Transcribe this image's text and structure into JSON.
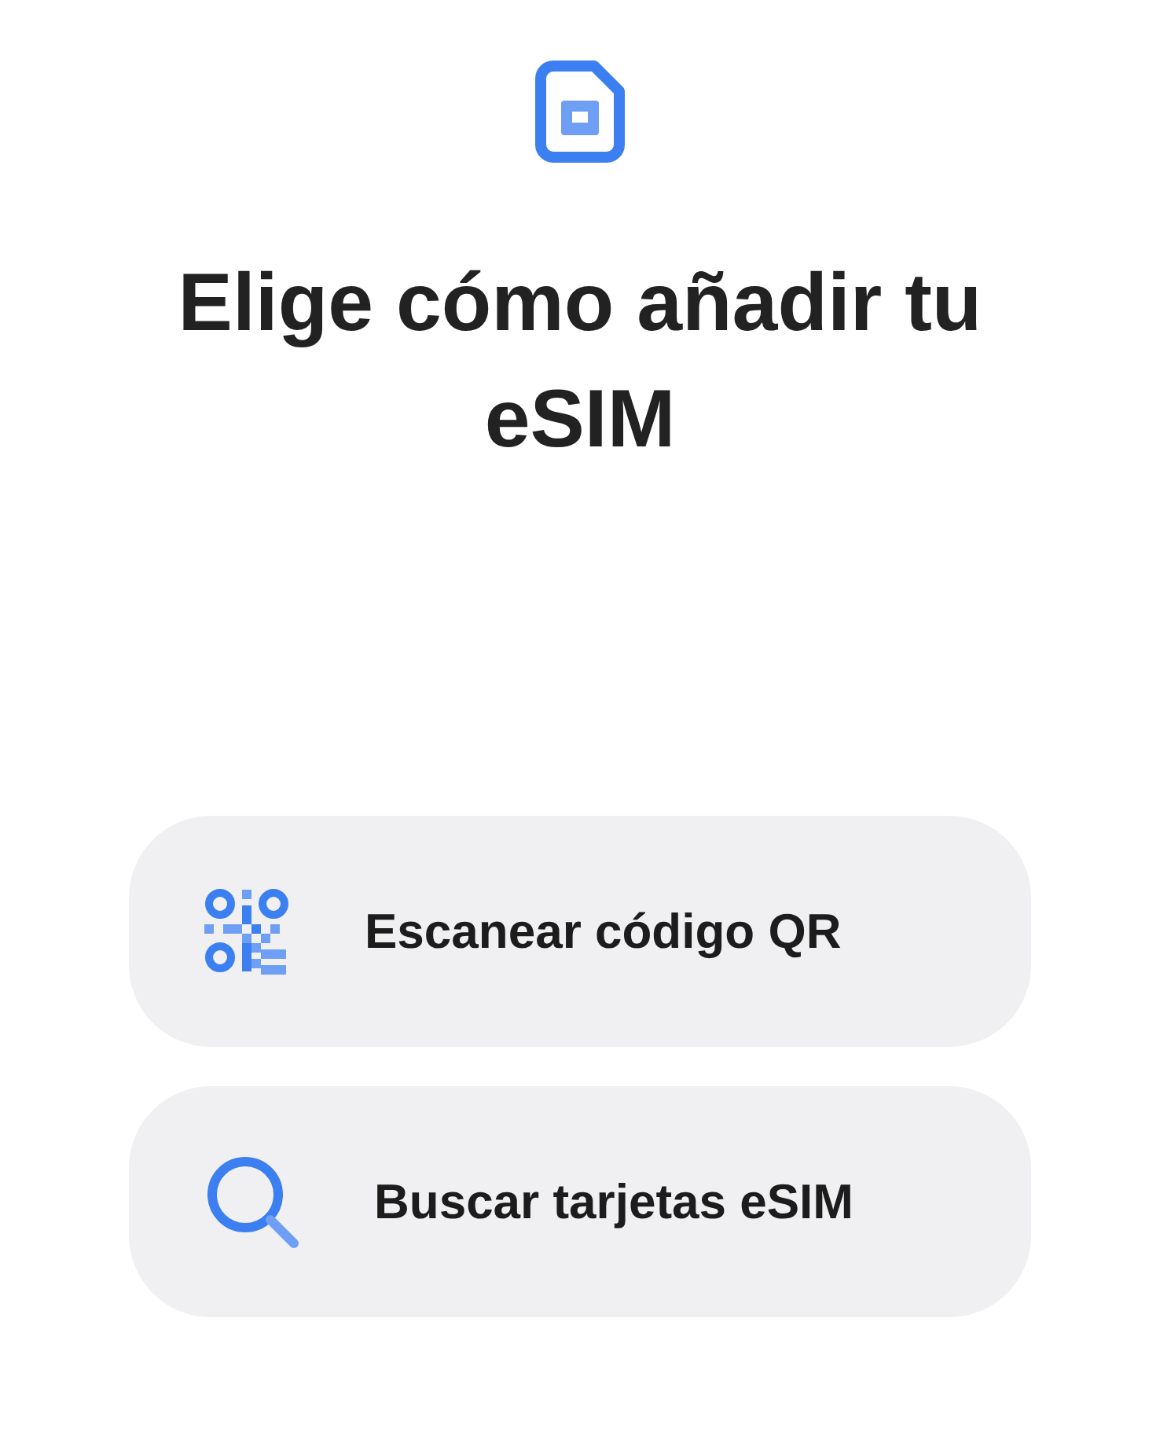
{
  "title": "Elige cómo añadir tu eSIM",
  "options": [
    {
      "kind": "qr",
      "label": "Escanear código QR"
    },
    {
      "kind": "search",
      "label": "Buscar tarjetas eSIM"
    }
  ]
}
